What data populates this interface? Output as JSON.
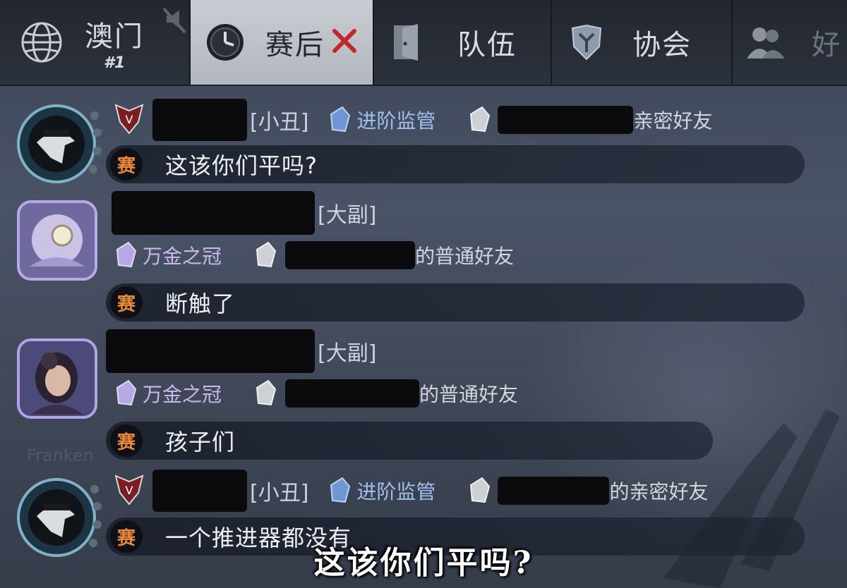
{
  "tabs": {
    "region_label": "澳门",
    "region_rank": "#1",
    "postgame_label": "赛后",
    "team_label": "队伍",
    "guild_label": "协会",
    "friends_label": "好"
  },
  "messages": [
    {
      "role": "[小丑]",
      "badge": "进阶监管",
      "relation": "亲密好友",
      "text": "这该你们平吗?"
    },
    {
      "role": "[大副]",
      "badge": "万金之冠",
      "relation": "的普通好友",
      "text": "断触了"
    },
    {
      "role": "[大副]",
      "badge": "万金之冠",
      "relation": "的普通好友",
      "text": "孩子们"
    },
    {
      "role": "[小丑]",
      "badge": "进阶监管",
      "relation": "的亲密好友",
      "text": "一个推进器都没有"
    }
  ],
  "match_marker": "赛",
  "subtitle": "这该你们平吗?",
  "background_text": "Franken",
  "colors": {
    "accent_orange": "#e88a3a",
    "badge_blue": "#9fc0ee",
    "badge_purple": "#c8b8ec",
    "active_tab": "#c9ccd1"
  },
  "icons": [
    "globe-icon",
    "mute-icon",
    "clock-icon",
    "close-icon",
    "door-icon",
    "shield-icon",
    "friends-icon",
    "gem-icon",
    "rank-crest-icon"
  ]
}
